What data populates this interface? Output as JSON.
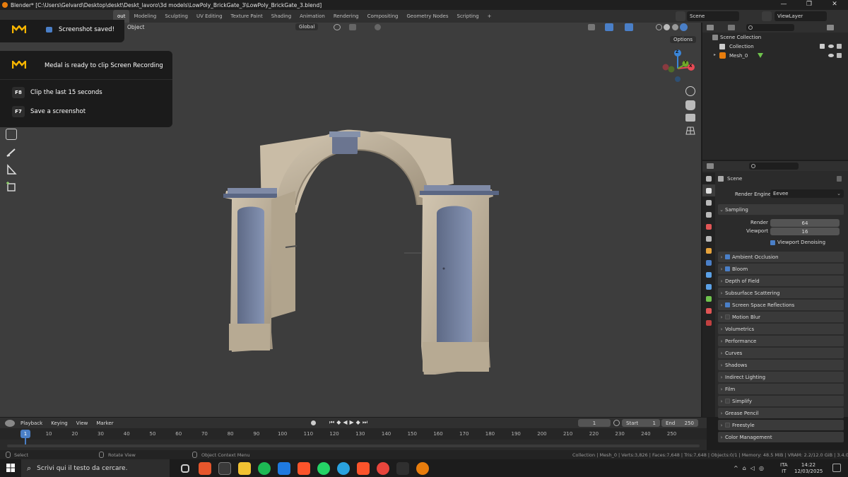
{
  "window": {
    "title": "Blender* [C:\\Users\\Gelvard\\Desktop\\deskt\\Deskt_lavoro\\3d models\\LowPoly_BrickGate_3\\LowPoly_BrickGate_3.blend]",
    "minimize": "—",
    "maximize": "❐",
    "close": "✕"
  },
  "workspaces": [
    "out",
    "Modeling",
    "Sculpting",
    "UV Editing",
    "Texture Paint",
    "Shading",
    "Animation",
    "Rendering",
    "Compositing",
    "Geometry Nodes",
    "Scripting"
  ],
  "workspace_add": "+",
  "scene_name": "Scene",
  "view_layer": "ViewLayer",
  "viewport": {
    "object_menu": "Object",
    "transform_orientation": "Global",
    "options_label": "Options",
    "gizmo_axes": {
      "z": "Z",
      "x": "X",
      "y": "Y"
    }
  },
  "medal": {
    "saved_text": "Screenshot saved!",
    "ready_text": "Medal is ready to clip Screen Recording",
    "actions": [
      {
        "key": "F8",
        "label": "Clip the last 15 seconds"
      },
      {
        "key": "F7",
        "label": "Save a screenshot"
      }
    ]
  },
  "outliner": {
    "root": "Scene Collection",
    "items": [
      {
        "label": "Collection"
      },
      {
        "label": "Mesh_0"
      }
    ]
  },
  "properties": {
    "context": "Scene",
    "render_engine_label": "Render Engine",
    "render_engine": "Eevee",
    "sampling": {
      "title": "Sampling",
      "render_label": "Render",
      "render_value": "64",
      "viewport_label": "Viewport",
      "viewport_value": "16",
      "denoise_label": "Viewport Denoising"
    },
    "panels": [
      {
        "label": "Ambient Occlusion",
        "checkbox": true,
        "checked": true
      },
      {
        "label": "Bloom",
        "checkbox": true,
        "checked": true
      },
      {
        "label": "Depth of Field",
        "checkbox": false,
        "checked": false
      },
      {
        "label": "Subsurface Scattering",
        "checkbox": false,
        "checked": false
      },
      {
        "label": "Screen Space Reflections",
        "checkbox": true,
        "checked": true
      },
      {
        "label": "Motion Blur",
        "checkbox": true,
        "checked": false
      },
      {
        "label": "Volumetrics",
        "checkbox": false,
        "checked": false
      },
      {
        "label": "Performance",
        "checkbox": false,
        "checked": false
      },
      {
        "label": "Curves",
        "checkbox": false,
        "checked": false
      },
      {
        "label": "Shadows",
        "checkbox": false,
        "checked": false
      },
      {
        "label": "Indirect Lighting",
        "checkbox": false,
        "checked": false
      },
      {
        "label": "Film",
        "checkbox": false,
        "checked": false
      },
      {
        "label": "Simplify",
        "checkbox": true,
        "checked": false
      },
      {
        "label": "Grease Pencil",
        "checkbox": false,
        "checked": false
      },
      {
        "label": "Freestyle",
        "checkbox": true,
        "checked": false
      },
      {
        "label": "Color Management",
        "checkbox": false,
        "checked": false
      }
    ]
  },
  "timeline": {
    "menus": [
      "Playback",
      "Keying",
      "View",
      "Marker"
    ],
    "current_frame": "1",
    "start_label": "Start",
    "start": "1",
    "end_label": "End",
    "end": "250",
    "ruler": [
      "1",
      "10",
      "20",
      "30",
      "40",
      "50",
      "60",
      "70",
      "80",
      "90",
      "100",
      "110",
      "120",
      "130",
      "140",
      "150",
      "160",
      "170",
      "180",
      "190",
      "200",
      "210",
      "220",
      "230",
      "240",
      "250"
    ]
  },
  "statusbar": {
    "select": "Select",
    "rotate": "Rotate View",
    "context_menu": "Object Context Menu",
    "stats": "Collection | Mesh_0 | Verts:3,826 | Faces:7,648 | Tris:7,648 | Objects:0/1 | Memory: 48.5 MiB | VRAM: 2.2/12.0 GiB | 3.4.0"
  },
  "taskbar": {
    "search_placeholder": "Scrivi qui il testo da cercare.",
    "lang_top": "ITA",
    "lang_bottom": "IT",
    "time": "14:22",
    "date": "12/03/2025"
  },
  "colors": {
    "accent_blue": "#4a7fc7",
    "blender_orange": "#e87d0d",
    "medal_yellow": "#f7b500",
    "axis_x": "#e84a55",
    "axis_y": "#6fa928",
    "axis_z": "#3b86d9",
    "stone": "#c6b9a3",
    "door": "#7482a0"
  }
}
